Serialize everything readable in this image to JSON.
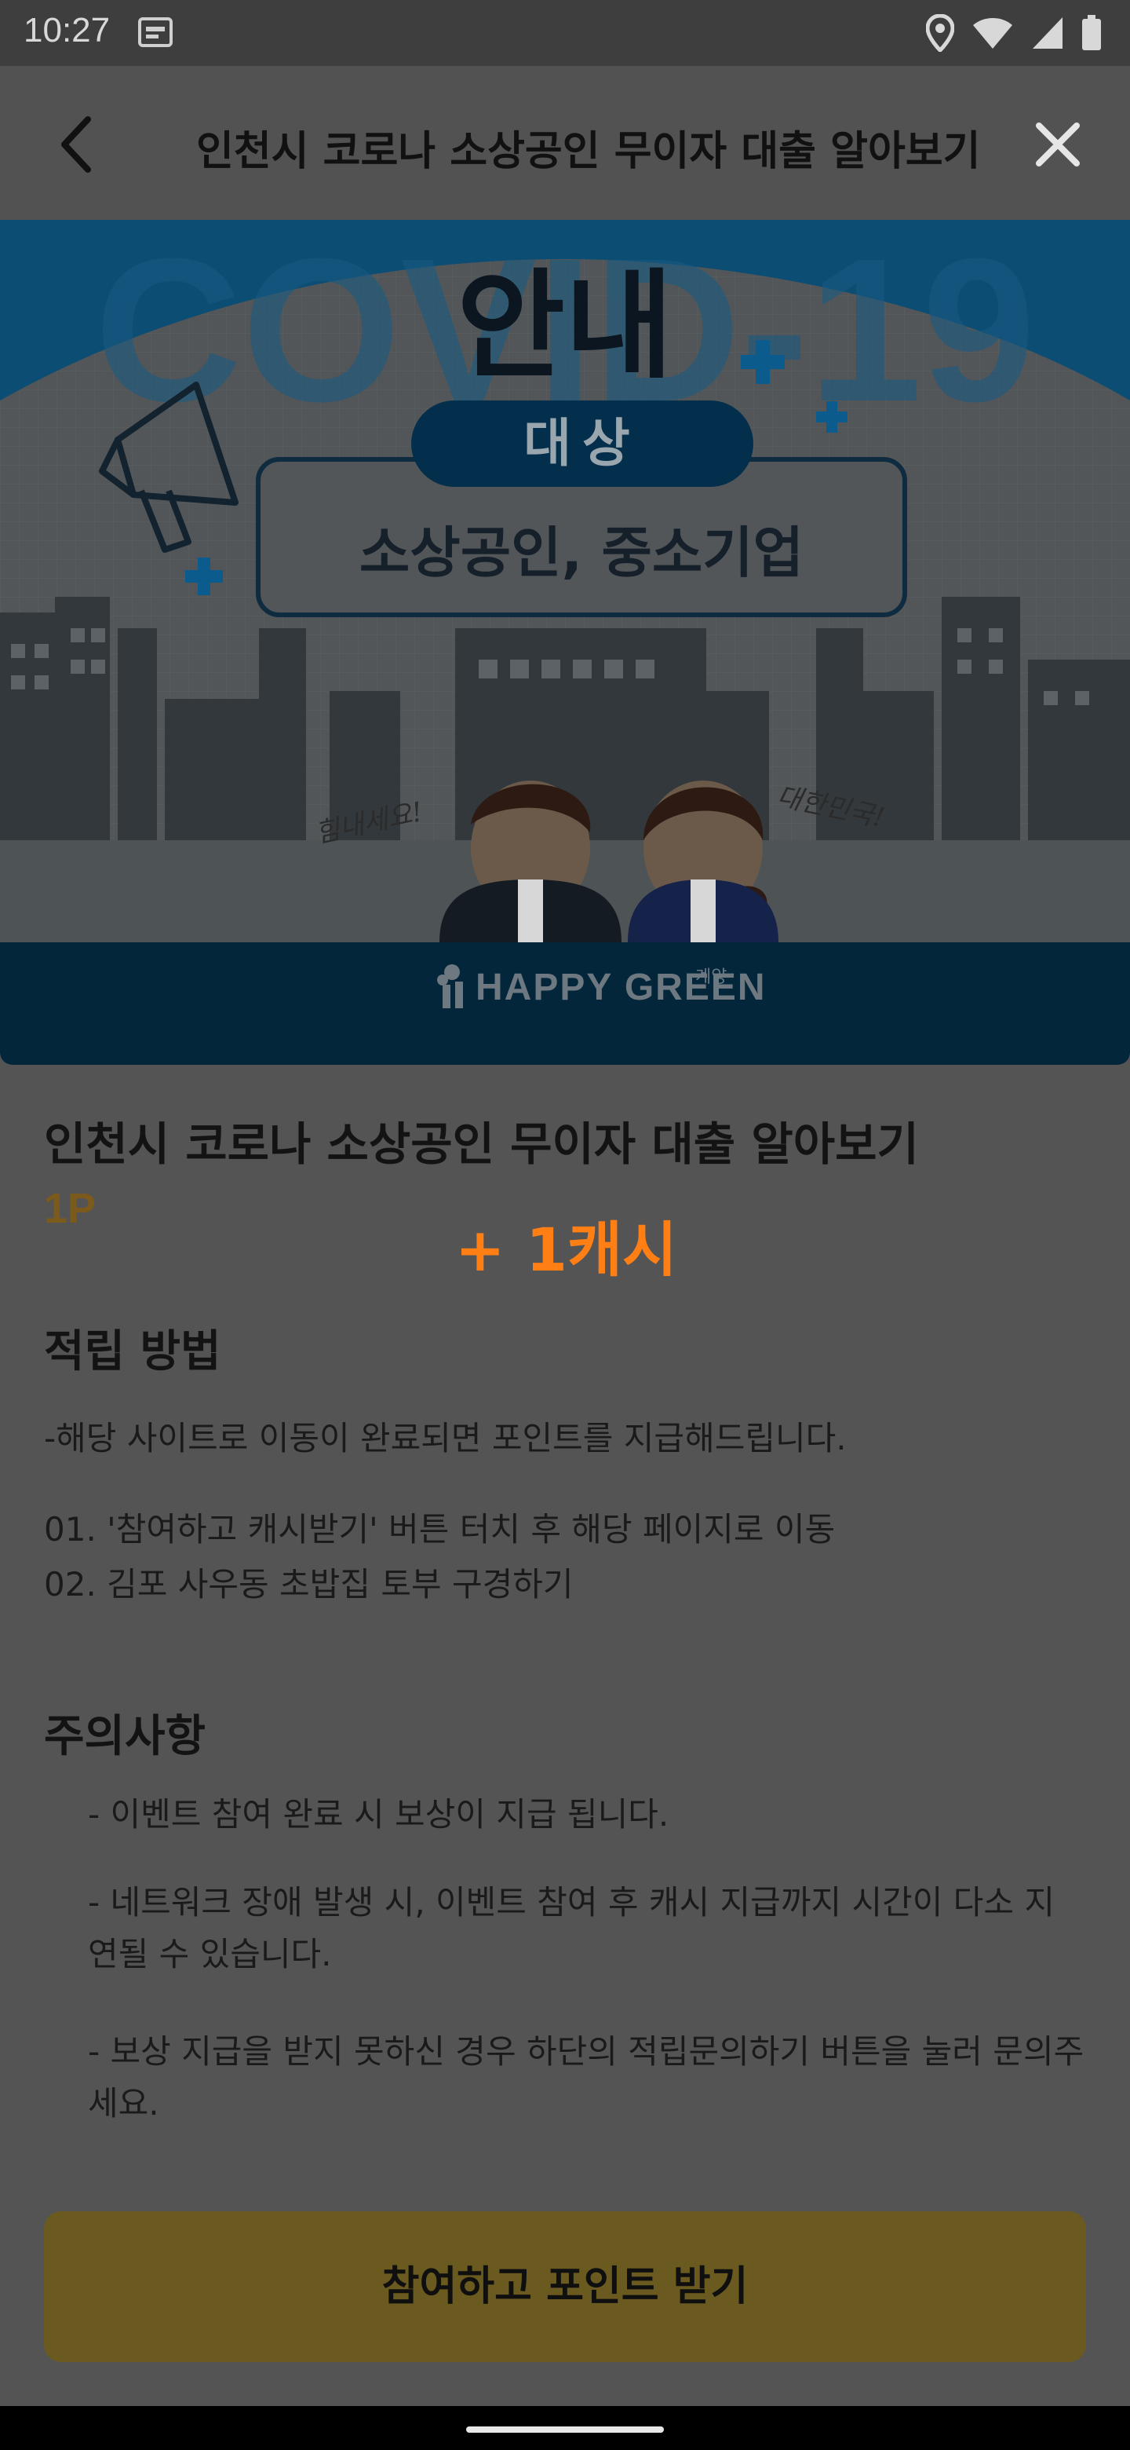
{
  "status_bar": {
    "time": "10:27",
    "icons": [
      "notification-icon",
      "location-icon",
      "wifi-icon",
      "signal-icon",
      "battery-icon"
    ]
  },
  "header": {
    "title": "인천시 코로나 소상공인 무이자 대출 알아보기",
    "back_icon": "chevron-left-icon",
    "close_icon": "close-icon"
  },
  "banner": {
    "heading": "안내",
    "background_text": "COVID-19",
    "target_label": "대상",
    "target_value": "소상공인, 중소기업",
    "handwriting_left": "힘내세요!",
    "handwriting_right": "대한민국!",
    "logo": "HAPPY GREEN",
    "logo_small": "계양"
  },
  "content": {
    "title": "인천시 코로나 소상공인 무이자 대출 알아보기",
    "points": "1P",
    "cash_reward": "+ 1캐시"
  },
  "earning_method": {
    "heading": "적립 방법",
    "description": "-해당 사이트로 이동이 완료되면 포인트를 지급해드립니다.",
    "steps": [
      "01. '참여하고 캐시받기' 버튼 터치 후 해당 페이지로 이동",
      "02. 김포 사우동 초밥집 토부 구경하기"
    ]
  },
  "notices": {
    "heading": "주의사항",
    "items": [
      "- 이벤트 참여 완료 시 보상이 지급 됩니다.",
      "- 네트워크 장애 발생 시, 이벤트 참여 후 캐시 지급까지 시간이 다소 지연될 수 있습니다.",
      "- 보상 지급을 받지 못하신 경우 하단의 적립문의하기 버튼을 눌러 문의주세요."
    ]
  },
  "cta": {
    "label": "참여하고 포인트 받기"
  },
  "colors": {
    "accent_orange": "#ff7f15",
    "cta_yellow": "#6a5a1f",
    "banner_navy": "#03263b"
  }
}
